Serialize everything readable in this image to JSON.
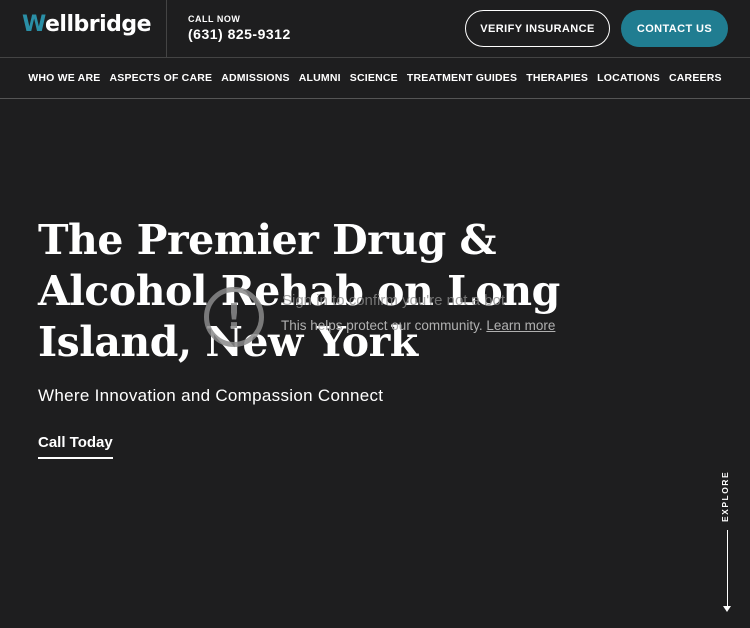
{
  "header": {
    "logo_w": "W",
    "logo_rest": "ellbridge",
    "call_label": "CALL NOW",
    "phone": "(631) 825-9312",
    "verify_label": "VERIFY INSURANCE",
    "contact_label": "CONTACT US"
  },
  "nav": {
    "items": [
      {
        "label": "WHO WE ARE"
      },
      {
        "label": "ASPECTS OF CARE"
      },
      {
        "label": "ADMISSIONS"
      },
      {
        "label": "ALUMNI"
      },
      {
        "label": "SCIENCE"
      },
      {
        "label": "TREATMENT GUIDES"
      },
      {
        "label": "THERAPIES"
      },
      {
        "label": "LOCATIONS"
      },
      {
        "label": "CAREERS"
      }
    ]
  },
  "hero": {
    "title": "The Premier Drug & Alcohol Rehab on Long Island, New York",
    "subtitle": "Where Innovation and Compassion Connect",
    "cta": "Call Today"
  },
  "overlay": {
    "icon": "exclamation-circle-icon",
    "title": "Sign in to confirm you're not a bot",
    "text": "This helps protect our community.",
    "link": "Learn more"
  },
  "explore": {
    "label": "EXPLORE"
  },
  "colors": {
    "background": "#1e1e1f",
    "accent": "#207d91"
  }
}
